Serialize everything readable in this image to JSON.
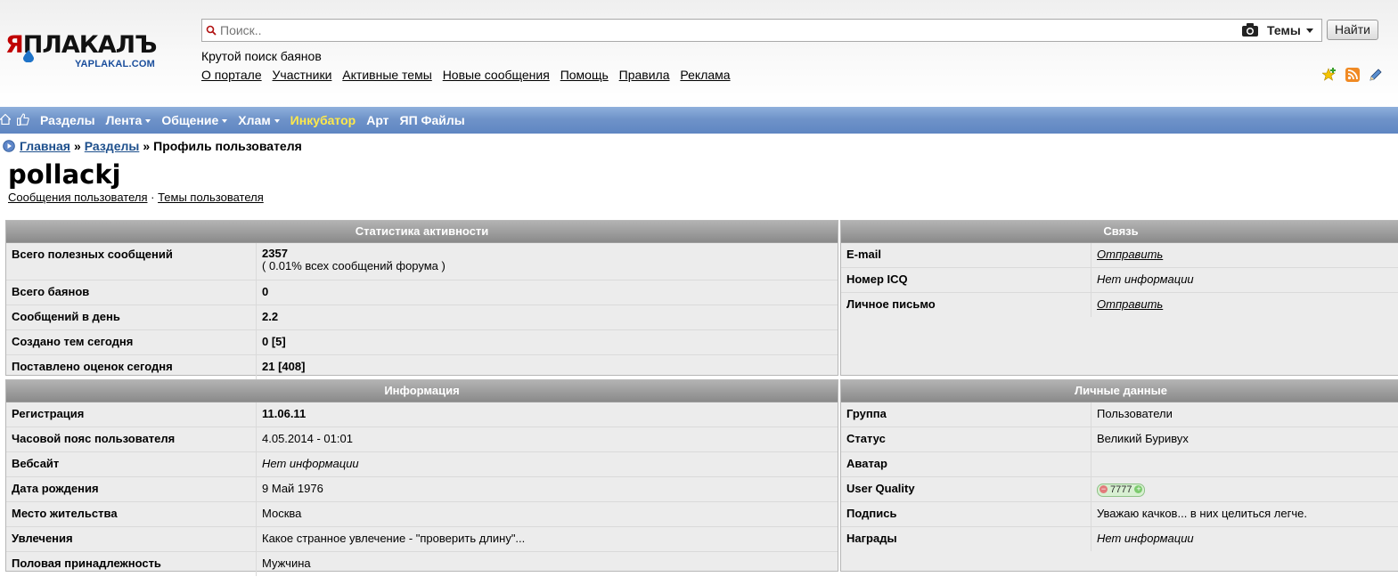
{
  "logo": {
    "text_first": "Я",
    "text_rest": "ПЛАКАЛЪ",
    "subtitle": "YAPLAKAL.COM"
  },
  "search": {
    "placeholder": "Поиск..",
    "scope": "Темы",
    "button": "Найти"
  },
  "tagline": "Крутой поиск баянов",
  "top_links": [
    "О портале",
    "Участники",
    "Активные темы",
    "Новые сообщения",
    "Помощь",
    "Правила",
    "Реклама"
  ],
  "header_icons": [
    "star-add-icon",
    "rss-icon",
    "pencil-icon"
  ],
  "nav": {
    "icons": [
      "home-icon",
      "thumbs-up-icon"
    ],
    "items": [
      {
        "label": "Разделы",
        "dropdown": false
      },
      {
        "label": "Лента",
        "dropdown": true
      },
      {
        "label": "Общение",
        "dropdown": true
      },
      {
        "label": "Хлам",
        "dropdown": true
      },
      {
        "label": "Инкубатор",
        "dropdown": false,
        "highlight": "#ffe94a"
      },
      {
        "label": "Арт",
        "dropdown": false
      },
      {
        "label": "ЯП Файлы",
        "dropdown": false
      }
    ]
  },
  "breadcrumb": {
    "home": "Главная",
    "sep": "»",
    "sections": "Разделы",
    "current": "Профиль пользователя"
  },
  "profile": {
    "username": "pollackj",
    "link_posts": "Сообщения пользователя",
    "link_sep": "·",
    "link_topics": "Темы пользователя"
  },
  "stats": {
    "title": "Статистика активности",
    "rows": [
      {
        "label": "Всего полезных сообщений",
        "value": "2357",
        "note": "( 0.01% всех сообщений форума )"
      },
      {
        "label": "Всего баянов",
        "value": "0"
      },
      {
        "label": "Сообщений в день",
        "value": "2.2"
      },
      {
        "label": "Создано тем сегодня",
        "value": "0 [5]"
      },
      {
        "label": "Поставлено оценок сегодня",
        "value": "21 [408]"
      }
    ]
  },
  "contact": {
    "title": "Связь",
    "rows": [
      {
        "label": "E-mail",
        "value": "Отправить"
      },
      {
        "label": "Номер ICQ",
        "value": "Нет информации"
      },
      {
        "label": "Личное письмо",
        "value": "Отправить"
      }
    ]
  },
  "info": {
    "title": "Информация",
    "rows": [
      {
        "label": "Регистрация",
        "value": "11.06.11"
      },
      {
        "label": "Часовой пояс пользователя",
        "value": "4.05.2014 - 01:01"
      },
      {
        "label": "Вебсайт",
        "value": "Нет информации"
      },
      {
        "label": "Дата рождения",
        "value": "9 Май 1976"
      },
      {
        "label": "Место жительства",
        "value": "Москва"
      },
      {
        "label": "Увлечения",
        "value": "Какое странное увлечение - \"проверить длину\"..."
      },
      {
        "label": "Половая принадлежность",
        "value": "Мужчина"
      }
    ]
  },
  "personal": {
    "title": "Личные данные",
    "rows": [
      {
        "label": "Группа",
        "value": "Пользователи"
      },
      {
        "label": "Статус",
        "value": "Великий Буривух"
      },
      {
        "label": "Аватар",
        "value": ""
      },
      {
        "label": "User Quality",
        "value": "7777",
        "minus": "−",
        "plus": "+"
      },
      {
        "label": "Подпись",
        "value": "Уважаю качков... в них целиться легче."
      },
      {
        "label": "Награды",
        "value": "Нет информации"
      }
    ]
  }
}
